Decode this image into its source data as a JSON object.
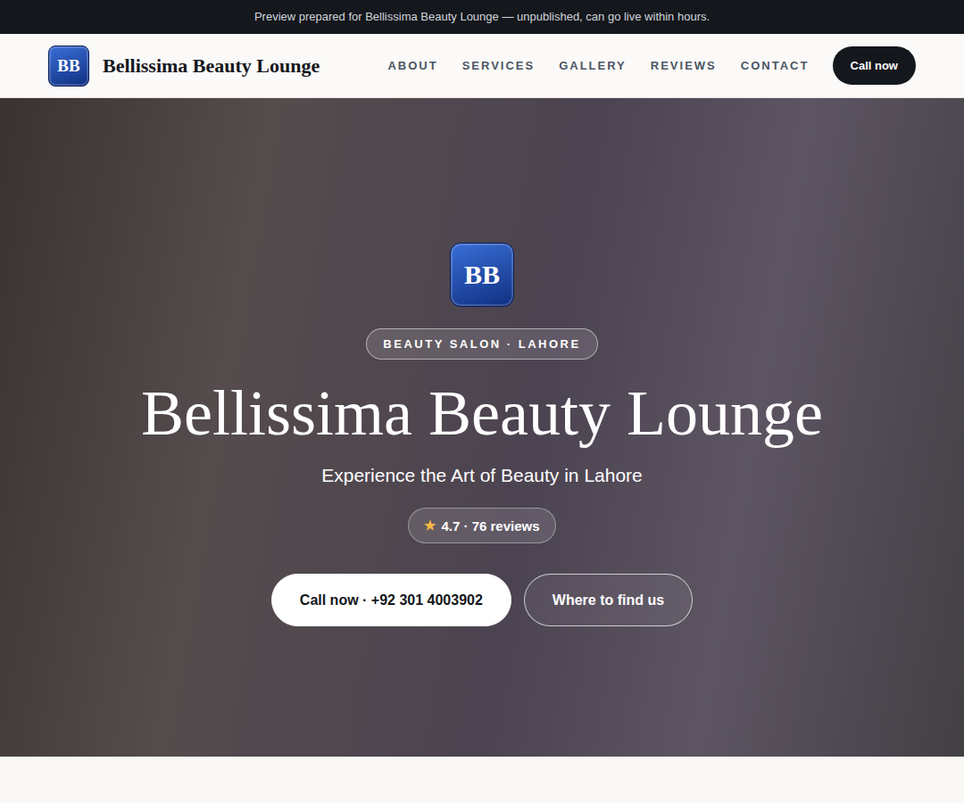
{
  "banner": {
    "text": "Preview prepared for Bellissima Beauty Lounge — unpublished, can go live within hours."
  },
  "header": {
    "logo": "BB",
    "name": "Bellissima Beauty Lounge",
    "nav": [
      "ABOUT",
      "SERVICES",
      "GALLERY",
      "REVIEWS",
      "CONTACT"
    ],
    "cta": "Call now"
  },
  "hero": {
    "logo": "BB",
    "badge": "BEAUTY SALON · LAHORE",
    "title": "Bellissima Beauty Lounge",
    "subtitle": "Experience the Art of Beauty in Lahore",
    "rating": {
      "star": "★",
      "text": "4.7 · 76 reviews"
    },
    "buttons": [
      {
        "label": "Call now · +92 301 4003902",
        "kind": "primary"
      },
      {
        "label": "Where to find us",
        "kind": "outline"
      }
    ]
  }
}
